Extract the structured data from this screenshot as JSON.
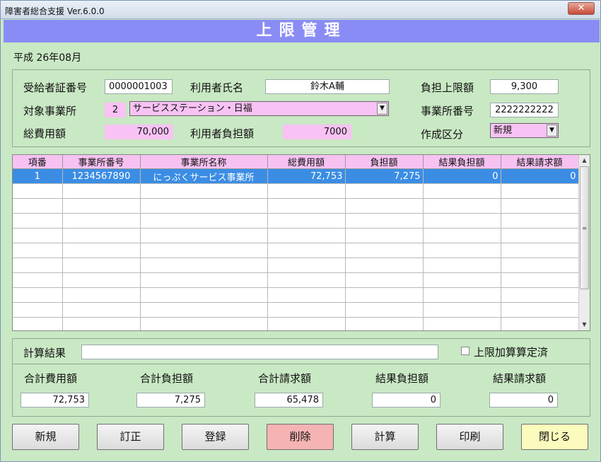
{
  "window": {
    "title": "障害者総合支援 Ver.6.0.0",
    "close_glyph": "✕"
  },
  "header": {
    "title": "上限管理"
  },
  "period": "平成 26年08月",
  "info": {
    "recipient_no_label": "受給者証番号",
    "recipient_no": "0000001003",
    "user_name_label": "利用者氏名",
    "user_name": "鈴木A輔",
    "limit_label": "負担上限額",
    "limit": "9,300",
    "facility_label": "対象事業所",
    "facility_no": "2",
    "facility_name": "サービスステーション・日福",
    "facility_code_label": "事業所番号",
    "facility_code": "2222222222",
    "total_cost_label": "総費用額",
    "total_cost": "70,000",
    "user_burden_label": "利用者負担額",
    "user_burden": "7000",
    "create_type_label": "作成区分",
    "create_type": "新規"
  },
  "grid": {
    "columns": [
      "項番",
      "事業所番号",
      "事業所名称",
      "総費用額",
      "負担額",
      "結果負担額",
      "結果請求額"
    ],
    "rows": [
      [
        "1",
        "1234567890",
        "にっぷくサービス事業所",
        "72,753",
        "7,275",
        "0",
        "0"
      ]
    ],
    "empty_rows": 11
  },
  "result": {
    "calc_result_label": "計算結果",
    "calc_result": "",
    "limit_added_label": "上限加算算定済",
    "limit_added_checked": false,
    "totals": [
      {
        "label": "合計費用額",
        "value": "72,753"
      },
      {
        "label": "合計負担額",
        "value": "7,275"
      },
      {
        "label": "合計請求額",
        "value": "65,478"
      },
      {
        "label": "結果負担額",
        "value": "0"
      },
      {
        "label": "結果請求額",
        "value": "0"
      }
    ]
  },
  "buttons": {
    "new": "新規",
    "edit": "訂正",
    "register": "登録",
    "delete": "削除",
    "calculate": "計算",
    "print": "印刷",
    "close": "閉じる"
  },
  "colors": {
    "header": "#8a8cf5",
    "pink": "#f8c2f4",
    "selected_row": "#3b8de4",
    "background": "#c9e8c4"
  }
}
